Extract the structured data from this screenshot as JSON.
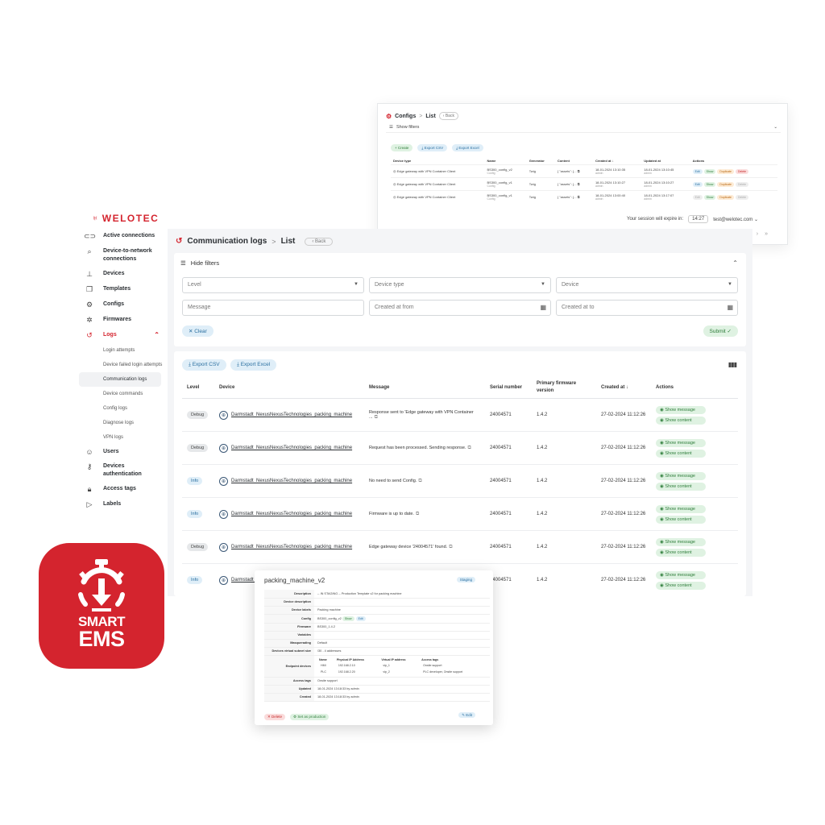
{
  "configs_window": {
    "title": "Configs",
    "breadcrumb_sep": ">",
    "breadcrumb_current": "List",
    "back_label": "Back",
    "show_filters": "Show filters",
    "buttons": [
      "Create",
      "Export CSV",
      "Export Excel"
    ],
    "columns": [
      "Device type",
      "Name",
      "Generator",
      "Content",
      "Created at",
      "Updated at",
      "Actions"
    ],
    "rows": [
      {
        "device_type": "Edge gateway with VPN Container Client",
        "name": "BS300_config_v2",
        "name_sub": "Config",
        "generator": "Twig",
        "content": "{ \"assets\": {...",
        "created": "18-01-2024 13:10:35",
        "created_by": "admin",
        "updated": "18-01-2024 13:10:45",
        "updated_by": "admin"
      },
      {
        "device_type": "Edge gateway with VPN Container Client",
        "name": "BS300_config_v1",
        "name_sub": "Config",
        "generator": "Twig",
        "content": "{ \"assets\": {...",
        "created": "18-01-2024 13:10:27",
        "created_by": "admin",
        "updated": "18-01-2024 13:10:27",
        "updated_by": "admin"
      },
      {
        "device_type": "Edge gateway with VPN Container Client",
        "name": "BS300_config_v1",
        "name_sub": "Config",
        "generator": "Twig",
        "content": "{ \"assets\": {...",
        "created": "18-01-2024 13:00:40",
        "created_by": "admin",
        "updated": "18-01-2024 13:17:07",
        "updated_by": "admin"
      }
    ],
    "row_actions": [
      "Edit",
      "Show",
      "Duplicate",
      "Delete"
    ],
    "session_text": "Your session will expire in:",
    "session_time": "14:27",
    "user_email": "test@welotec.com"
  },
  "sidebar": {
    "logo": "WELOTEC",
    "items": [
      {
        "label": "Active connections",
        "icon": "link-icon"
      },
      {
        "label": "Device-to-network connections",
        "icon": "search-network-icon"
      },
      {
        "label": "Devices",
        "icon": "router-icon"
      },
      {
        "label": "Templates",
        "icon": "copy-icon"
      },
      {
        "label": "Configs",
        "icon": "gear-icon"
      },
      {
        "label": "Firmwares",
        "icon": "chip-icon"
      },
      {
        "label": "Logs",
        "icon": "history-icon"
      }
    ],
    "log_subitems": [
      "Login attempts",
      "Device failed login attempts",
      "Communication logs",
      "Device commands",
      "Config logs",
      "Diagnose logs",
      "VPN logs"
    ],
    "items_after": [
      {
        "label": "Users",
        "icon": "user-icon"
      },
      {
        "label": "Devices authentication",
        "icon": "key-icon"
      },
      {
        "label": "Access tags",
        "icon": "lock-icon"
      },
      {
        "label": "Labels",
        "icon": "label-icon"
      }
    ]
  },
  "main": {
    "title": "Communication logs",
    "breadcrumb_sep": ">",
    "breadcrumb_current": "List",
    "back_label": "Back",
    "hide_filters": "Hide filters",
    "filters": {
      "level": "Level",
      "device_type": "Device type",
      "device": "Device",
      "message": "Message",
      "created_from": "Created at from",
      "created_to": "Created at to"
    },
    "clear_label": "Clear",
    "submit_label": "Submit",
    "export_csv": "Export CSV",
    "export_excel": "Export Excel",
    "columns": {
      "level": "Level",
      "device": "Device",
      "message": "Message",
      "serial": "Serial number",
      "firmware": "Primary firmware version",
      "created": "Created at",
      "actions": "Actions"
    },
    "show_message": "Show message",
    "show_content": "Show content",
    "rows": [
      {
        "level": "Debug",
        "device": "Darmstadt_NexusNexusTechnologies_packing_machine",
        "message": "Response sent to 'Edge gateway with VPN Container ...",
        "serial": "24004571",
        "firmware": "1.4.2",
        "created": "27-02-2024 11:12:26"
      },
      {
        "level": "Debug",
        "device": "Darmstadt_NexusNexusTechnologies_packing_machine",
        "message": "Request has been processed. Sending response.",
        "serial": "24004571",
        "firmware": "1.4.2",
        "created": "27-02-2024 11:12:26"
      },
      {
        "level": "Info",
        "device": "Darmstadt_NexusNexusTechnologies_packing_machine",
        "message": "No need to send Config.",
        "serial": "24004571",
        "firmware": "1.4.2",
        "created": "27-02-2024 11:12:26"
      },
      {
        "level": "Info",
        "device": "Darmstadt_NexusNexusTechnologies_packing_machine",
        "message": "Firmware is up to date.",
        "serial": "24004571",
        "firmware": "1.4.2",
        "created": "27-02-2024 11:12:26"
      },
      {
        "level": "Debug",
        "device": "Darmstadt_NexusNexusTechnologies_packing_machine",
        "message": "Edge gateway device '24004571' found.",
        "serial": "24004571",
        "firmware": "1.4.2",
        "created": "27-02-2024 11:12:26"
      },
      {
        "level": "Info",
        "device": "Darmstadt_NexusNexusTechnologies_packing_machine",
        "message": "",
        "serial": "24004571",
        "firmware": "1.4.2",
        "created": "27-02-2024 11:12:26"
      }
    ]
  },
  "detail": {
    "title": "packing_machine_v2",
    "badge": "Staging",
    "rows": [
      {
        "key": "Description",
        "value": "-- IN STAGING -- Production Template v2 for packing machine"
      },
      {
        "key": "Device description",
        "value": ""
      },
      {
        "key": "Device labels",
        "value": "Packing machine"
      },
      {
        "key": "Config",
        "value": "BS300_config_v2"
      },
      {
        "key": "Firmware",
        "value": "BS300_1.4.2"
      },
      {
        "key": "Variables",
        "value": ""
      },
      {
        "key": "Masquerading",
        "value": "Default"
      },
      {
        "key": "Devices virtual subnet size",
        "value": "/30 - 4 addresses"
      }
    ],
    "config_show": "Show",
    "config_edit": "Edit",
    "endpoint_key": "Endpoint devices",
    "endpoint_cols": [
      "Name",
      "Physical IP Address",
      "Virtual IP address",
      "Access tags"
    ],
    "endpoints": [
      {
        "name": "HMI",
        "pip": "192.168.2.10",
        "vip": "vip_1",
        "tags": "Onsite support"
      },
      {
        "name": "PLC",
        "pip": "192.168.2.20",
        "vip": "vip_2",
        "tags": "PLC developer, Onsite support"
      }
    ],
    "rows_after": [
      {
        "key": "Access tags",
        "value": "Onsite support"
      },
      {
        "key": "Updated",
        "value": "18-01-2024 13:18:33 by admin"
      },
      {
        "key": "Created",
        "value": "18-01-2024 13:18:33 by admin"
      }
    ],
    "delete": "Delete",
    "set_prod": "Set as production",
    "edit": "Edit"
  },
  "badge": {
    "line1": "SMART",
    "line2": "EMS"
  },
  "colors": {
    "brand": "#d4242e",
    "green_bg": "#dff2e2",
    "blue_bg": "#dfeef8"
  }
}
